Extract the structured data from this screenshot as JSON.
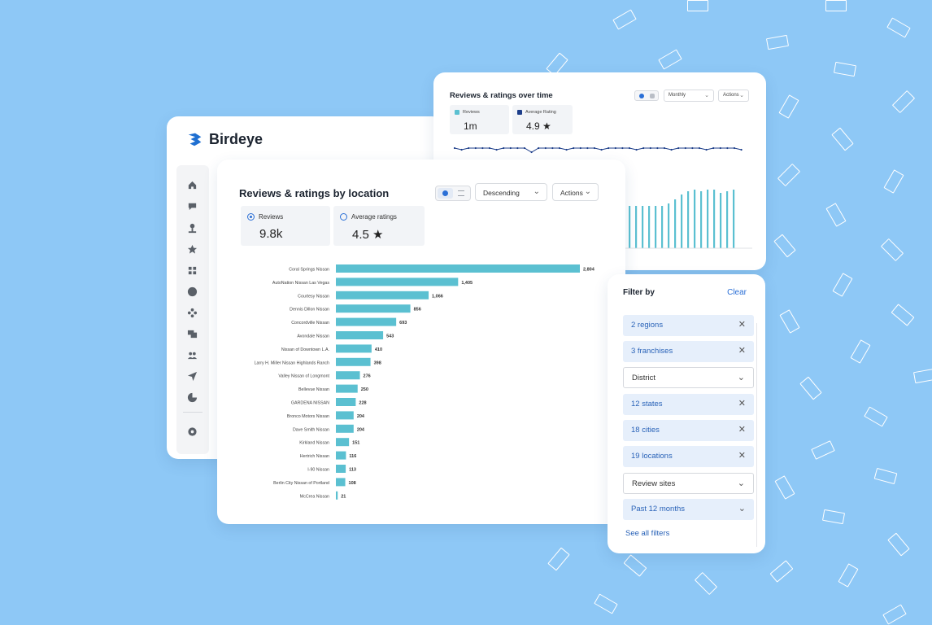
{
  "brand": {
    "name": "Birdeye",
    "color": "#1f6fd1"
  },
  "sidebar": {
    "items": [
      {
        "icon": "home-icon"
      },
      {
        "icon": "chat-icon"
      },
      {
        "icon": "location-pin-icon"
      },
      {
        "icon": "star-icon"
      },
      {
        "icon": "grid-icon"
      },
      {
        "icon": "dollar-icon"
      },
      {
        "icon": "workflow-icon"
      },
      {
        "icon": "messages-icon"
      },
      {
        "icon": "people-icon"
      },
      {
        "icon": "send-icon"
      },
      {
        "icon": "pie-chart-icon"
      },
      {
        "icon": "settings-icon"
      }
    ]
  },
  "time_card": {
    "title": "Reviews & ratings over time",
    "period": "Monthly",
    "actions": "Actions",
    "stats": [
      {
        "label": "Reviews",
        "value": "1m",
        "color": "#5bc0d1"
      },
      {
        "label": "Average Rating",
        "value": "4.9 ★",
        "color": "#1d3e8a"
      }
    ]
  },
  "loc_card": {
    "title": "Reviews & ratings by location",
    "sort": "Descending",
    "actions": "Actions",
    "stats": [
      {
        "label": "Reviews",
        "value": "9.8k"
      },
      {
        "label": "Average ratings",
        "value": "4.5 ★"
      }
    ]
  },
  "chart_data": {
    "type": "bar",
    "orientation": "horizontal",
    "color": "#5bc0d1",
    "categories": [
      "Coral Springs Nissan",
      "AutoNation Nissan Las Vegas",
      "Courtesy Nissan",
      "Dennis Dillon Nissan",
      "Concordville Nissan",
      "Avondale Nissan",
      "Nissan of Downtown L.A.",
      "Larry H. Miller Nissan Highlands Ranch",
      "Valley Nissan of Longmont",
      "Bellevue Nissan",
      "GARDENA NISSAN",
      "Bronco Motors Nissan",
      "Dave Smith Nissan",
      "Kirkland Nissan",
      "Hertrich Nissan",
      "I-90 Nissan",
      "Berlin City Nissan of Portland",
      "McCrea Nissan"
    ],
    "values": [
      2804,
      1405,
      1066,
      856,
      693,
      543,
      410,
      398,
      276,
      250,
      228,
      204,
      204,
      151,
      116,
      113,
      108,
      21
    ],
    "labels": [
      "2,804",
      "1,405",
      "1,066",
      "856",
      "693",
      "543",
      "410",
      "398",
      "276",
      "250",
      "228",
      "204",
      "204",
      "151",
      "116",
      "113",
      "108",
      "21"
    ]
  },
  "filter": {
    "title": "Filter by",
    "clear": "Clear",
    "chips": [
      {
        "label": "2 regions",
        "active": true
      },
      {
        "label": "3 franchises",
        "active": true
      },
      {
        "label": "District",
        "active": false
      },
      {
        "label": "12 states",
        "active": true
      },
      {
        "label": "18 cities",
        "active": true
      },
      {
        "label": "19 locations",
        "active": true
      },
      {
        "label": "Review sites",
        "active": false
      },
      {
        "label": "Past 12 months",
        "active": true,
        "dropdown": true
      }
    ],
    "see_all": "See all filters"
  }
}
